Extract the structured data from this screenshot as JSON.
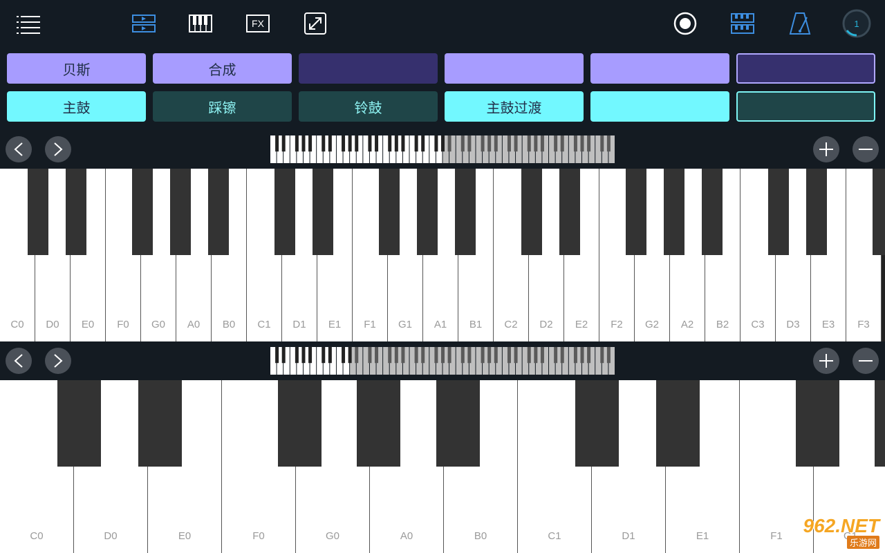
{
  "toolbar": {
    "fx_label": "FX",
    "tempo_value": "1",
    "colors": {
      "accent_blue": "#3d8ee0",
      "icon_white": "#ffffff",
      "dial_teal": "#28b4d8"
    }
  },
  "pads": {
    "row1": [
      {
        "label": "贝斯",
        "state": "light"
      },
      {
        "label": "合成",
        "state": "light"
      },
      {
        "label": "",
        "state": "dark"
      },
      {
        "label": "",
        "state": "light"
      },
      {
        "label": "",
        "state": "light"
      },
      {
        "label": "",
        "state": "dark-selected"
      }
    ],
    "row2": [
      {
        "label": "主鼓",
        "state": "light"
      },
      {
        "label": "踩镲",
        "state": "dark"
      },
      {
        "label": "铃鼓",
        "state": "dark"
      },
      {
        "label": "主鼓过渡",
        "state": "light"
      },
      {
        "label": "",
        "state": "light"
      },
      {
        "label": "",
        "state": "dark-selected"
      }
    ],
    "colors": {
      "purple_light": "#a79cff",
      "purple_dark": "#36306e",
      "cyan_light": "#72f8ff",
      "teal_dark": "#1f4548",
      "text_light": "#22304a",
      "text_teal": "#8ef2f2"
    }
  },
  "keyboard1": {
    "white_keys": [
      "C0",
      "D0",
      "E0",
      "F0",
      "G0",
      "A0",
      "B0",
      "C1",
      "D1",
      "E1",
      "F1",
      "G1",
      "A1",
      "B1",
      "C2",
      "D2",
      "E2",
      "F2",
      "G2",
      "A2",
      "B2",
      "C3",
      "D3",
      "E3",
      "F3"
    ],
    "minimap_highlight_fraction": 0.5
  },
  "keyboard2": {
    "white_keys": [
      "C0",
      "D0",
      "E0",
      "F0",
      "G0",
      "A0",
      "B0",
      "C1",
      "D1",
      "E1",
      "F1",
      "G1"
    ],
    "minimap_highlight_fraction": 0.24
  },
  "watermark": {
    "main": "962.NET",
    "sub": "乐游网"
  }
}
